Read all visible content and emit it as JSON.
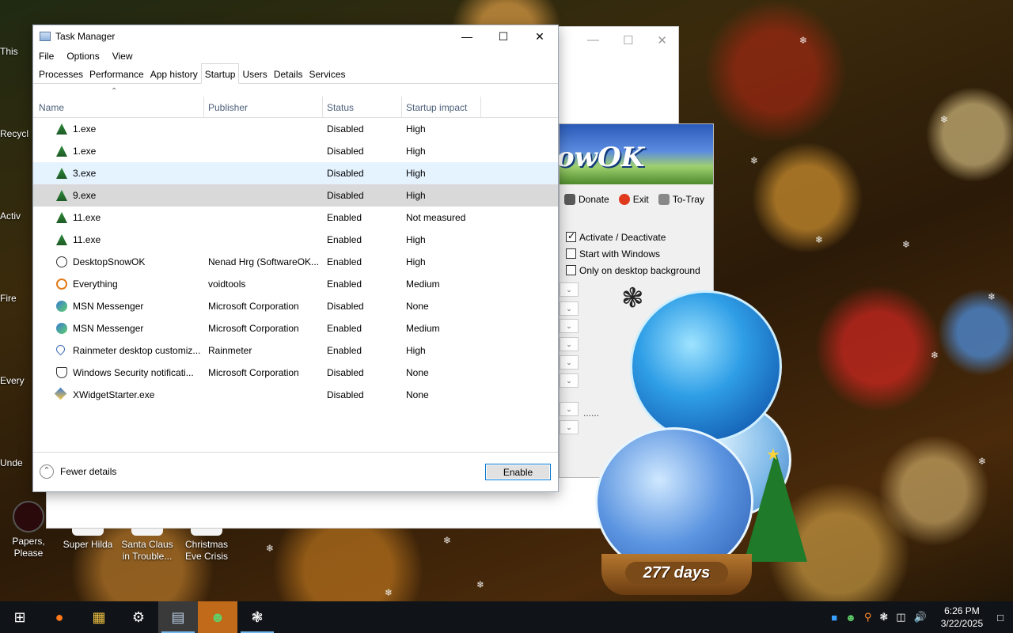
{
  "desktop": {
    "icons": [
      {
        "label": "Papers, Please",
        "color": "#2a0a0a"
      },
      {
        "label": "Super Hilda",
        "color": "#ffffff"
      },
      {
        "label": "Santa Claus in Trouble...",
        "color": "#ffffff"
      },
      {
        "label": "Christmas Eve Crisis",
        "color": "#ffffff"
      }
    ],
    "edge_labels": [
      "This",
      "Recycl",
      "Activ",
      "Fire",
      "Every",
      "Unde"
    ]
  },
  "task_manager": {
    "title": "Task Manager",
    "caption_buttons": {
      "minimize": "—",
      "maximize": "☐",
      "close": "✕"
    },
    "menu": [
      "File",
      "Options",
      "View"
    ],
    "tabs": [
      "Processes",
      "Performance",
      "App history",
      "Startup",
      "Users",
      "Details",
      "Services"
    ],
    "active_tab": "Startup",
    "columns": {
      "name": "Name",
      "publisher": "Publisher",
      "status": "Status",
      "impact": "Startup impact"
    },
    "rows": [
      {
        "name": "1.exe",
        "publisher": "",
        "status": "Disabled",
        "impact": "High",
        "icon": "tree-icon"
      },
      {
        "name": "1.exe",
        "publisher": "",
        "status": "Disabled",
        "impact": "High",
        "icon": "tree-icon"
      },
      {
        "name": "3.exe",
        "publisher": "",
        "status": "Disabled",
        "impact": "High",
        "icon": "tree-icon"
      },
      {
        "name": "9.exe",
        "publisher": "",
        "status": "Disabled",
        "impact": "High",
        "icon": "tree-icon"
      },
      {
        "name": "11.exe",
        "publisher": "",
        "status": "Enabled",
        "impact": "Not measured",
        "icon": "tree-icon"
      },
      {
        "name": "11.exe",
        "publisher": "",
        "status": "Enabled",
        "impact": "High",
        "icon": "tree-icon"
      },
      {
        "name": "DesktopSnowOK",
        "publisher": "Nenad Hrg (SoftwareOK...",
        "status": "Enabled",
        "impact": "High",
        "icon": "snowflake-icon"
      },
      {
        "name": "Everything",
        "publisher": "voidtools",
        "status": "Enabled",
        "impact": "Medium",
        "icon": "magnifier-icon"
      },
      {
        "name": "MSN Messenger",
        "publisher": "Microsoft Corporation",
        "status": "Disabled",
        "impact": "None",
        "icon": "messenger-icon"
      },
      {
        "name": "MSN Messenger",
        "publisher": "Microsoft Corporation",
        "status": "Enabled",
        "impact": "Medium",
        "icon": "messenger-icon"
      },
      {
        "name": "Rainmeter desktop customiz...",
        "publisher": "Rainmeter",
        "status": "Enabled",
        "impact": "High",
        "icon": "droplet-icon"
      },
      {
        "name": "Windows Security notificati...",
        "publisher": "Microsoft Corporation",
        "status": "Disabled",
        "impact": "None",
        "icon": "shield-icon"
      },
      {
        "name": "XWidgetStarter.exe",
        "publisher": "",
        "status": "Disabled",
        "impact": "None",
        "icon": "xwidget-icon"
      }
    ],
    "fewer_details": "Fewer details",
    "enable_button": "Enable"
  },
  "snow_window": {
    "banner_text": "owOK",
    "toolbar": [
      "Donate",
      "Exit",
      "To-Tray"
    ],
    "checkboxes": [
      {
        "label": "Activate / Deactivate",
        "checked": true
      },
      {
        "label": "Start with Windows",
        "checked": false
      },
      {
        "label": "Only on desktop background",
        "checked": false
      }
    ],
    "dots": "......"
  },
  "days_widget": {
    "text": "277 days"
  },
  "taskbar": {
    "clock_time": "6:26 PM",
    "clock_date": "3/22/2025"
  },
  "colors": {
    "accent": "#0078d7",
    "hover_row": "#e5f3ff",
    "selected_row": "#d9d9d9",
    "taskbar": "#101418"
  }
}
